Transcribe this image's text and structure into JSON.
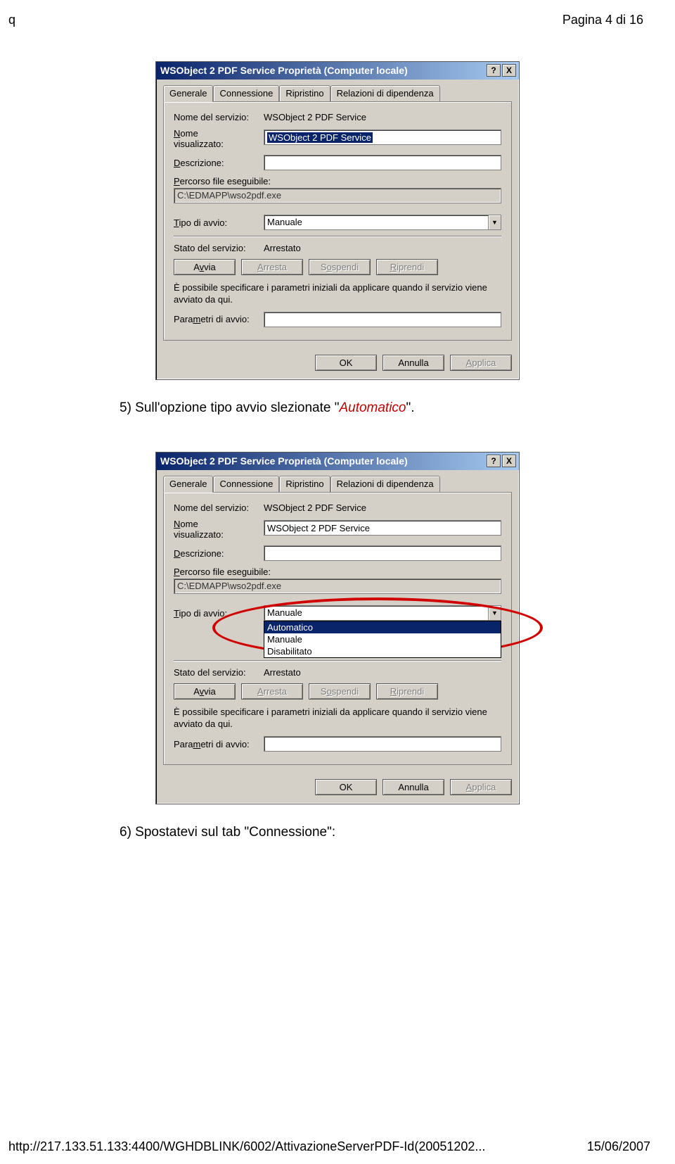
{
  "header": {
    "left": "q",
    "right": "Pagina 4 di 16"
  },
  "footer": {
    "left": "http://217.133.51.133:4400/WGHDBLINK/6002/AttivazioneServerPDF-Id(20051202...",
    "right": "15/06/2007"
  },
  "instr1": {
    "prefix": "5)  Sull'opzione tipo avvio slezionate \"",
    "em": "Automatico",
    "suffix": "\"."
  },
  "instr2": {
    "text": "6)  Spostatevi sul tab \"Connessione\":"
  },
  "dialog": {
    "title": "WSObject 2 PDF Service Proprietà (Computer locale)",
    "help": "?",
    "close": "X",
    "tabs": {
      "t1": "Generale",
      "t2": "Connessione",
      "t3": "Ripristino",
      "t4": "Relazioni di dipendenza"
    },
    "labels": {
      "nome_servizio": "Nome del servizio:",
      "nome_vis_1": "Nome",
      "nome_vis_2": "visualizzato:",
      "descrizione": "Descrizione:",
      "percorso": "Percorso file eseguibile:",
      "tipo_avvio": "Tipo di avvio:",
      "stato": "Stato del servizio:",
      "param": "Parametri di avvio:"
    },
    "vals": {
      "nome_servizio": "WSObject 2 PDF Service",
      "nome_vis": "WSObject 2 PDF Service",
      "percorso": "C:\\EDMAPP\\wso2pdf.exe",
      "tipo_avvio": "Manuale",
      "stato": "Arrestato"
    },
    "dropdown": {
      "o1": "Automatico",
      "o2": "Manuale",
      "o3": "Disabilitato"
    },
    "btns": {
      "avvia": "Avvia",
      "arresta": "Arresta",
      "sospendi": "Sospendi",
      "riprendi": "Riprendi"
    },
    "note": "È possibile specificare i parametri iniziali da applicare quando il servizio viene avviato da qui.",
    "footer": {
      "ok": "OK",
      "annulla": "Annulla",
      "applica": "Applica"
    }
  }
}
